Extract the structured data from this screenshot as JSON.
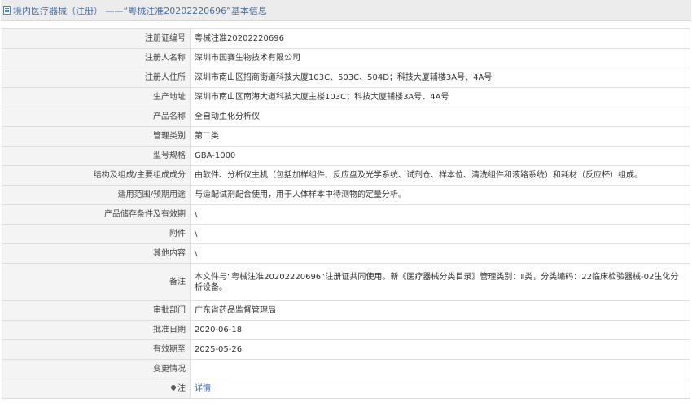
{
  "header": {
    "title": "境内医疗器械（注册） ——“粤械注准20202220696”基本信息"
  },
  "rows": [
    {
      "label": "注册证编号",
      "value": "粤械注准20202220696"
    },
    {
      "label": "注册人名称",
      "value": "深圳市国赛生物技术有限公司"
    },
    {
      "label": "注册人住所",
      "value": "深圳市南山区招商街道科技大厦103C、503C、504D；科技大厦辅楼3A号、4A号"
    },
    {
      "label": "生产地址",
      "value": "深圳市南山区南海大道科技大厦主楼103C；科技大厦辅楼3A号、4A号"
    },
    {
      "label": "产品名称",
      "value": "全自动生化分析仪"
    },
    {
      "label": "管理类别",
      "value": "第二类"
    },
    {
      "label": "型号规格",
      "value": "GBA-1000"
    },
    {
      "label": "结构及组成/主要组成成分",
      "value": "由软件、分析仪主机（包括加样组件、反应盘及光学系统、试剂仓、样本位、清洗组件和液路系统）和耗材（反应杯）组成。"
    },
    {
      "label": "适用范围/预期用途",
      "value": "与适配试剂配合使用，用于人体样本中待测物的定量分析。"
    },
    {
      "label": "产品储存条件及有效期",
      "value": "\\"
    },
    {
      "label": "附件",
      "value": "\\"
    },
    {
      "label": "其他内容",
      "value": "\\"
    },
    {
      "label": "备注",
      "value": "本文件与“粤械注准20202220696”注册证共同使用。新《医疗器械分类目录》管理类别：Ⅱ类，分类编码：22临床检验器械-02生化分析设备。"
    },
    {
      "label": "审批部门",
      "value": "广东省药品监督管理局"
    },
    {
      "label": "批准日期",
      "value": "2020-06-18"
    },
    {
      "label": "有效期至",
      "value": "2025-05-26"
    },
    {
      "label": "变更情况",
      "value": ""
    },
    {
      "label": "注",
      "value": "详情"
    }
  ]
}
